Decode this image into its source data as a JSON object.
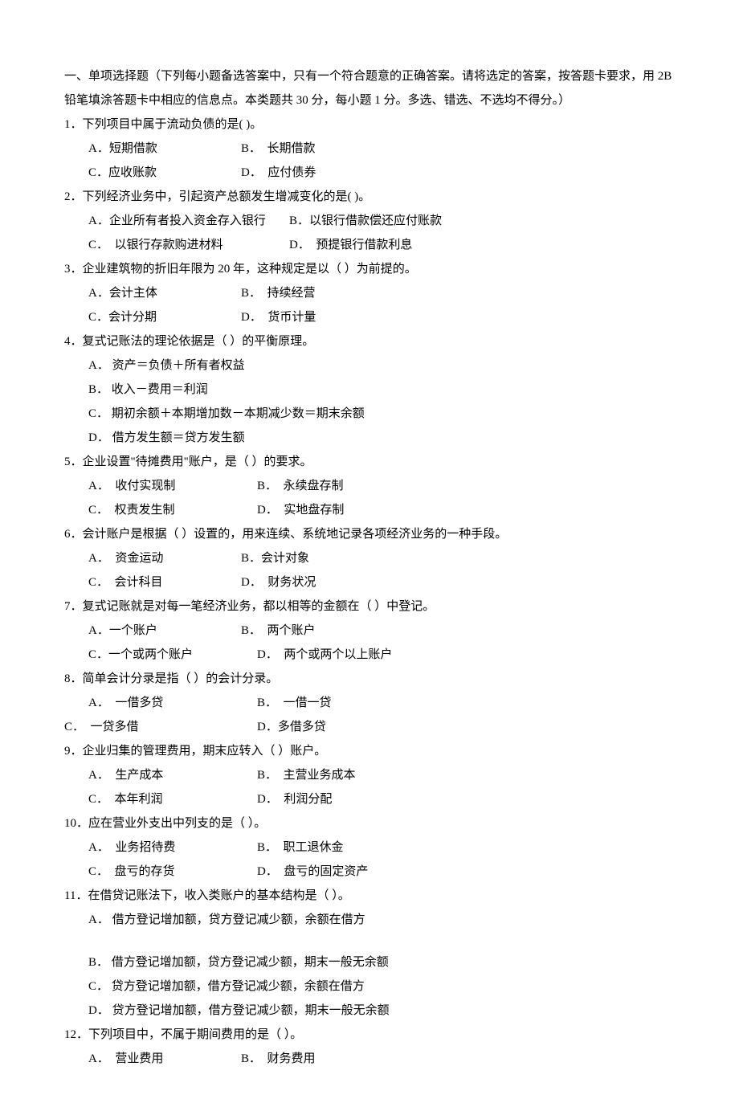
{
  "header": "一、单项选择题（下列每小题备选答案中，只有一个符合题意的正确答案。请将选定的答案，按答题卡要求，用 2B 铅笔填涂答题卡中相应的信息点。本类题共 30 分，每小题 1 分。多选、错选、不选均不得分。）",
  "q1": {
    "stem": "1．下列项目中属于流动负债的是( )。",
    "a": "A．短期借款",
    "b": "B．  长期借款",
    "c": "C．应收账款",
    "d": "D．  应付债券"
  },
  "q2": {
    "stem": "2．下列经济业务中，引起资产总额发生增减变化的是( )。",
    "a": "A．企业所有者投入资金存入银行",
    "b": "B．以银行借款偿还应付账款",
    "c": "C．  以银行存款购进材料",
    "d": "D．  预提银行借款利息"
  },
  "q3": {
    "stem": "3．企业建筑物的折旧年限为 20 年，这种规定是以（  ）为前提的。",
    "a": "A．会计主体",
    "b": "B．  持续经营",
    "c": "C．会计分期",
    "d": "D．  货币计量"
  },
  "q4": {
    "stem": "4．复式记账法的理论依据是（  ）的平衡原理。",
    "a": "A．  资产＝负债＋所有者权益",
    "b": "B．  收入－费用＝利润",
    "c": "C．  期初余额＋本期增加数－本期减少数＝期末余额",
    "d": "D．  借方发生额＝贷方发生额"
  },
  "q5": {
    "stem": "5．企业设置\"待摊费用\"账户，是（  ）的要求。",
    "a": "A．  收付实现制",
    "b": "B．  永续盘存制",
    "c": "C．  权责发生制",
    "d": "D．  实地盘存制"
  },
  "q6": {
    "stem": "6．会计账户是根据（  ）设置的，用来连续、系统地记录各项经济业务的一种手段。",
    "a": "A．  资金运动",
    "b": "B．会计对象",
    "c": "C．  会计科目",
    "d": "D．  财务状况"
  },
  "q7": {
    "stem": "7．复式记账就是对每一笔经济业务，都以相等的金额在（  ）中登记。",
    "a": "A．一个账户",
    "b": "B．  两个账户",
    "c": "C．一个或两个账户",
    "d": "D．  两个或两个以上账户"
  },
  "q8": {
    "stem": "8．简单会计分录是指（  ）的会计分录。",
    "a": "A．  一借多贷",
    "b": "B．  一借一贷",
    "c": "C．  一贷多借",
    "d": "D．多借多贷"
  },
  "q9": {
    "stem": "9．企业归集的管理费用，期末应转入（  ）账户。",
    "a": "A．  生产成本",
    "b": "B．  主营业务成本",
    "c": "C．  本年利润",
    "d": "D．  利润分配"
  },
  "q10": {
    "stem": "10．应在营业外支出中列支的是（  ）。",
    "a": "A．  业务招待费",
    "b": "B．  职工退休金",
    "c": "C．  盘亏的存货",
    "d": "D．  盘亏的固定资产"
  },
  "q11": {
    "stem": "11．在借贷记账法下，收入类账户的基本结构是（  ）。",
    "a": "A．  借方登记增加额，贷方登记减少额，余额在借方",
    "b": "B．  借方登记增加额，贷方登记减少额，期末一般无余额",
    "c": "C．  贷方登记增加额，借方登记减少额，余额在借方",
    "d": "D．  贷方登记增加额，借方登记减少额，期末一般无余额"
  },
  "q12": {
    "stem": "12．下列项目中，不属于期间费用的是（  ）。",
    "a": "A．  营业费用",
    "b": "B．  财务费用"
  }
}
